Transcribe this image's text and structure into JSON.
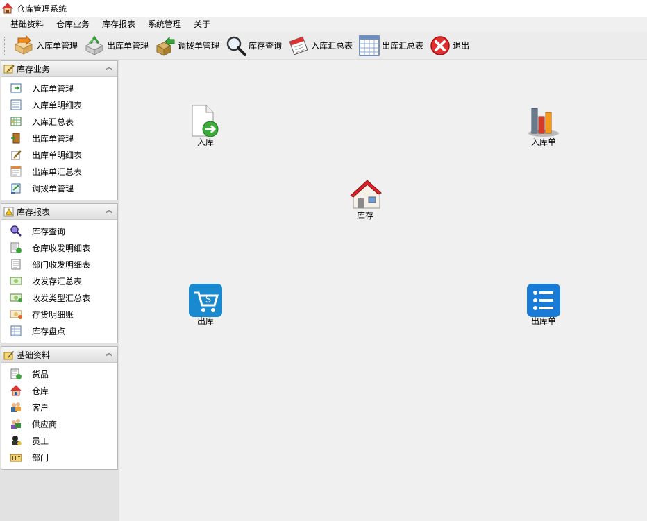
{
  "window": {
    "title": "仓库管理系统"
  },
  "menu": [
    "基础资料",
    "仓库业务",
    "库存报表",
    "系统管理",
    "关于"
  ],
  "toolbar": {
    "inbound_mgmt": "入库单管理",
    "outbound_mgmt": "出库单管理",
    "transfer_mgmt": "调拨单管理",
    "stock_query": "库存查询",
    "inbound_summary": "入库汇总表",
    "outbound_summary": "出库汇总表",
    "exit": "退出"
  },
  "panels": {
    "business": {
      "title": "库存业务",
      "items": [
        "入库单管理",
        "入库单明细表",
        "入库汇总表",
        "出库单管理",
        "出库单明细表",
        "出库单汇总表",
        "调拨单管理"
      ]
    },
    "reports": {
      "title": "库存报表",
      "items": [
        "库存查询",
        "仓库收发明细表",
        "部门收发明细表",
        "收发存汇总表",
        "收发类型汇总表",
        "存货明细账",
        "库存盘点"
      ]
    },
    "basic": {
      "title": "基础资料",
      "items": [
        "货品",
        "仓库",
        "客户",
        "供应商",
        "员工",
        "部门"
      ]
    }
  },
  "desktop": {
    "inbound": "入库",
    "inbound_order": "入库单",
    "stock": "库存",
    "outbound": "出库",
    "outbound_order": "出库单"
  }
}
